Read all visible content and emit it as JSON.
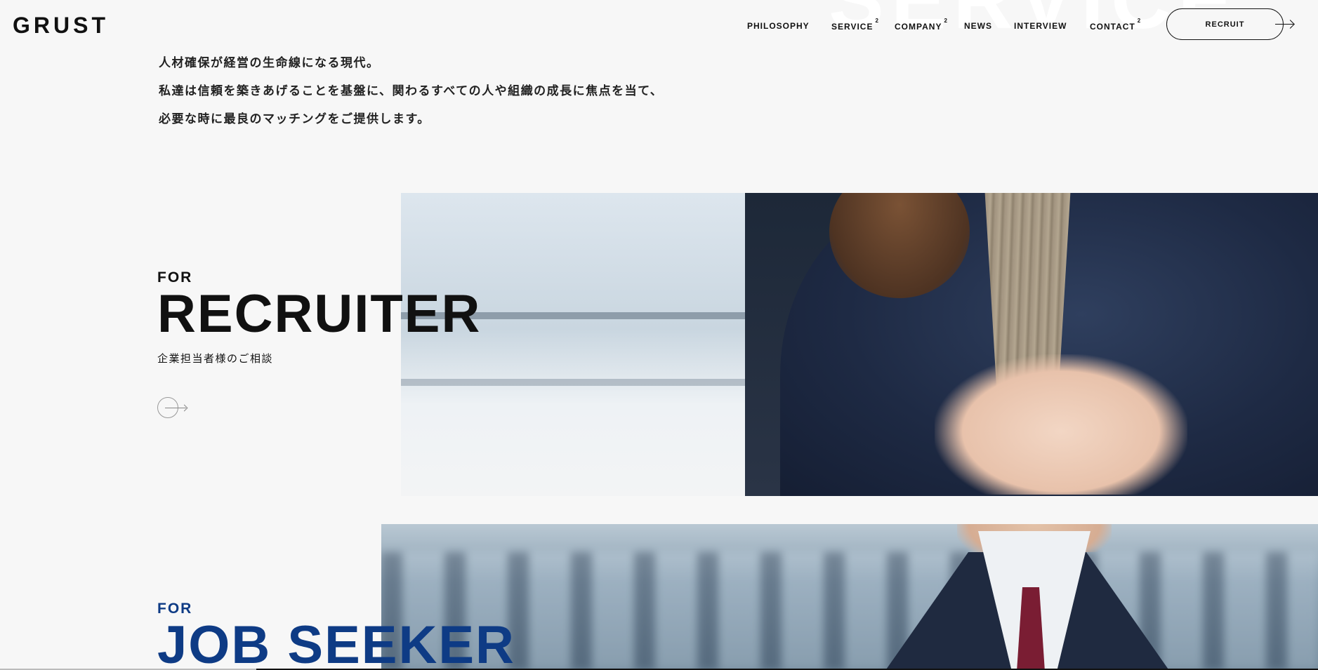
{
  "header": {
    "logo": "GRUST",
    "background_word": "SERVICE",
    "nav": [
      {
        "label": "PHILOSOPHY",
        "sup": ""
      },
      {
        "label": "SERVICE",
        "sup": "2"
      },
      {
        "label": "COMPANY",
        "sup": "2"
      },
      {
        "label": "NEWS",
        "sup": ""
      },
      {
        "label": "INTERVIEW",
        "sup": ""
      },
      {
        "label": "CONTACT",
        "sup": "2"
      }
    ],
    "recruit_label": "RECRUIT"
  },
  "intro": {
    "lines": [
      "人材確保が経営の生命線になる現代。",
      "私達は信頼を築きあげることを基盤に、関わるすべての人や組織の成長に焦点を当て、",
      "必要な時に最良のマッチングをご提供します。"
    ]
  },
  "recruiter": {
    "for": "FOR",
    "title": "RECRUITER",
    "subtitle": "企業担当者様のご相談"
  },
  "seeker": {
    "for": "FOR",
    "title": "JOB SEEKER"
  },
  "colors": {
    "background": "#f7f7f7",
    "text": "#111111",
    "seeker_accent": "#0e3b85"
  },
  "icons": {
    "recruit_arrow": "arrow-right-icon",
    "recruiter_link": "circle-arrow-icon"
  }
}
